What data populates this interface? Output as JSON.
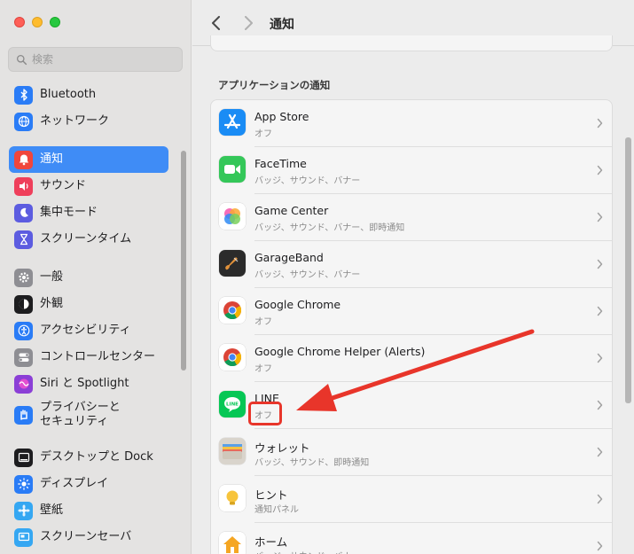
{
  "window": {
    "title": "通知"
  },
  "search": {
    "placeholder": "検索"
  },
  "sidebar": {
    "groups": [
      [
        {
          "label": "Bluetooth",
          "icon": "bluetooth-icon",
          "color": "#2a7cf6"
        },
        {
          "label": "ネットワーク",
          "icon": "globe-icon",
          "color": "#2a7cf6"
        }
      ],
      [
        {
          "label": "通知",
          "icon": "bell-icon",
          "color": "#f0463c",
          "active": true
        },
        {
          "label": "サウンド",
          "icon": "speaker-icon",
          "color": "#ef3f5b"
        },
        {
          "label": "集中モード",
          "icon": "moon-icon",
          "color": "#5c5ce0"
        },
        {
          "label": "スクリーンタイム",
          "icon": "hourglass-icon",
          "color": "#5c5ce0"
        }
      ],
      [
        {
          "label": "一般",
          "icon": "gear-icon",
          "color": "#8e8e93"
        },
        {
          "label": "外観",
          "icon": "appearance-icon",
          "color": "#1d1d1f"
        },
        {
          "label": "アクセシビリティ",
          "icon": "accessibility-icon",
          "color": "#2a7cf6"
        },
        {
          "label": "コントロールセンター",
          "icon": "toggles-icon",
          "color": "#8e8e93"
        },
        {
          "label": "Siri と Spotlight",
          "icon": "siri-icon",
          "color": "#8b3fd6"
        },
        {
          "label": "プライバシーと\nセキュリティ",
          "icon": "hand-icon",
          "color": "#2a7cf6"
        }
      ],
      [
        {
          "label": "デスクトップと Dock",
          "icon": "dock-icon",
          "color": "#1d1d1f"
        },
        {
          "label": "ディスプレイ",
          "icon": "brightness-icon",
          "color": "#2a7cf6"
        },
        {
          "label": "壁紙",
          "icon": "wallpaper-icon",
          "color": "#35a7f2"
        },
        {
          "label": "スクリーンセーバ",
          "icon": "screensaver-icon",
          "color": "#35a7f2"
        }
      ]
    ]
  },
  "main": {
    "section_title": "アプリケーションの通知",
    "apps": [
      {
        "name": "App Store",
        "sub": "オフ",
        "icon": "app-store-icon"
      },
      {
        "name": "FaceTime",
        "sub": "バッジ、サウンド、バナー",
        "icon": "facetime-icon"
      },
      {
        "name": "Game Center",
        "sub": "バッジ、サウンド、バナー、即時通知",
        "icon": "game-center-icon"
      },
      {
        "name": "GarageBand",
        "sub": "バッジ、サウンド、バナー",
        "icon": "garageband-icon"
      },
      {
        "name": "Google Chrome",
        "sub": "オフ",
        "icon": "chrome-icon"
      },
      {
        "name": "Google Chrome Helper (Alerts)",
        "sub": "オフ",
        "icon": "chrome-icon"
      },
      {
        "name": "LINE",
        "sub": "オフ",
        "icon": "line-icon"
      },
      {
        "name": "ウォレット",
        "sub": "バッジ、サウンド、即時通知",
        "icon": "wallet-icon"
      },
      {
        "name": "ヒント",
        "sub": "通知パネル",
        "icon": "tips-icon"
      },
      {
        "name": "ホーム",
        "sub": "バッジ、サウンド、バナー",
        "icon": "home-icon"
      }
    ]
  },
  "annotation": {
    "color": "#e8352a"
  }
}
